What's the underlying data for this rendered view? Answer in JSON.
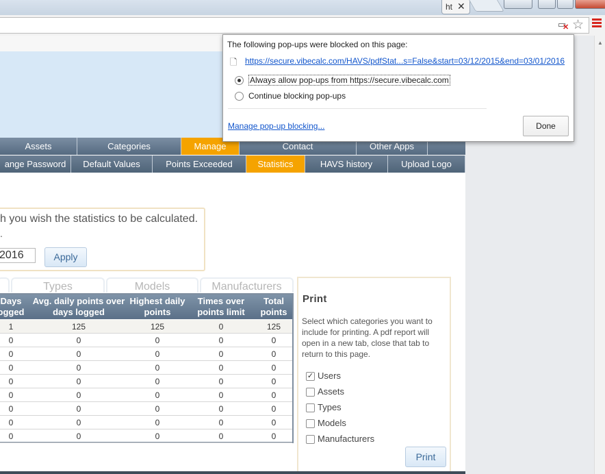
{
  "browser": {
    "tab_title": "ht",
    "tab_close": "✕"
  },
  "popup": {
    "message": "The following pop-ups were blocked on this page:",
    "blocked_url": "https://secure.vibecalc.com/HAVS/pdfStat...s=False&start=03/12/2015&end=03/01/2016",
    "options": [
      {
        "label": "Always allow pop-ups from https://secure.vibecalc.com",
        "selected": true
      },
      {
        "label": "Continue blocking pop-ups",
        "selected": false
      }
    ],
    "manage_link": "Manage pop-up blocking...",
    "done_label": "Done"
  },
  "nav": {
    "row1": [
      "Assets",
      "Categories",
      "Manage",
      "Contact",
      "Other Apps"
    ],
    "row2": [
      "ange Password",
      "Default Values",
      "Points Exceeded",
      "Statistics",
      "HAVS history",
      "Upload Logo"
    ],
    "active_row1": "Manage",
    "active_row2": "Statistics",
    "active_color": "#f5a300"
  },
  "date_filter": {
    "prompt": "h you wish the statistics to be calculated.",
    "dot": ".",
    "end_date_value": "2016",
    "apply_label": "Apply"
  },
  "subtabs": [
    "Types",
    "Models",
    "Manufacturers"
  ],
  "stats_table": {
    "headers": [
      [
        "Days",
        "ogged"
      ],
      [
        "Avg. daily points over",
        "days logged"
      ],
      [
        "Highest daily",
        "points"
      ],
      [
        "Times over",
        "points limit"
      ],
      [
        "Total",
        "points"
      ]
    ],
    "rows": [
      [
        "1",
        "125",
        "125",
        "0",
        "125"
      ],
      [
        "0",
        "0",
        "0",
        "0",
        "0"
      ],
      [
        "0",
        "0",
        "0",
        "0",
        "0"
      ],
      [
        "0",
        "0",
        "0",
        "0",
        "0"
      ],
      [
        "0",
        "0",
        "0",
        "0",
        "0"
      ],
      [
        "0",
        "0",
        "0",
        "0",
        "0"
      ],
      [
        "0",
        "0",
        "0",
        "0",
        "0"
      ],
      [
        "0",
        "0",
        "0",
        "0",
        "0"
      ],
      [
        "0",
        "0",
        "0",
        "0",
        "0"
      ]
    ]
  },
  "print_panel": {
    "title": "Print",
    "description": "Select which categories you want to include for printing.   A pdf report will open in a new tab, close that tab to return to this page.",
    "options": [
      {
        "label": "Users",
        "checked": true
      },
      {
        "label": "Assets",
        "checked": false
      },
      {
        "label": "Types",
        "checked": false
      },
      {
        "label": "Models",
        "checked": false
      },
      {
        "label": "Manufacturers",
        "checked": false
      }
    ],
    "print_label": "Print"
  }
}
